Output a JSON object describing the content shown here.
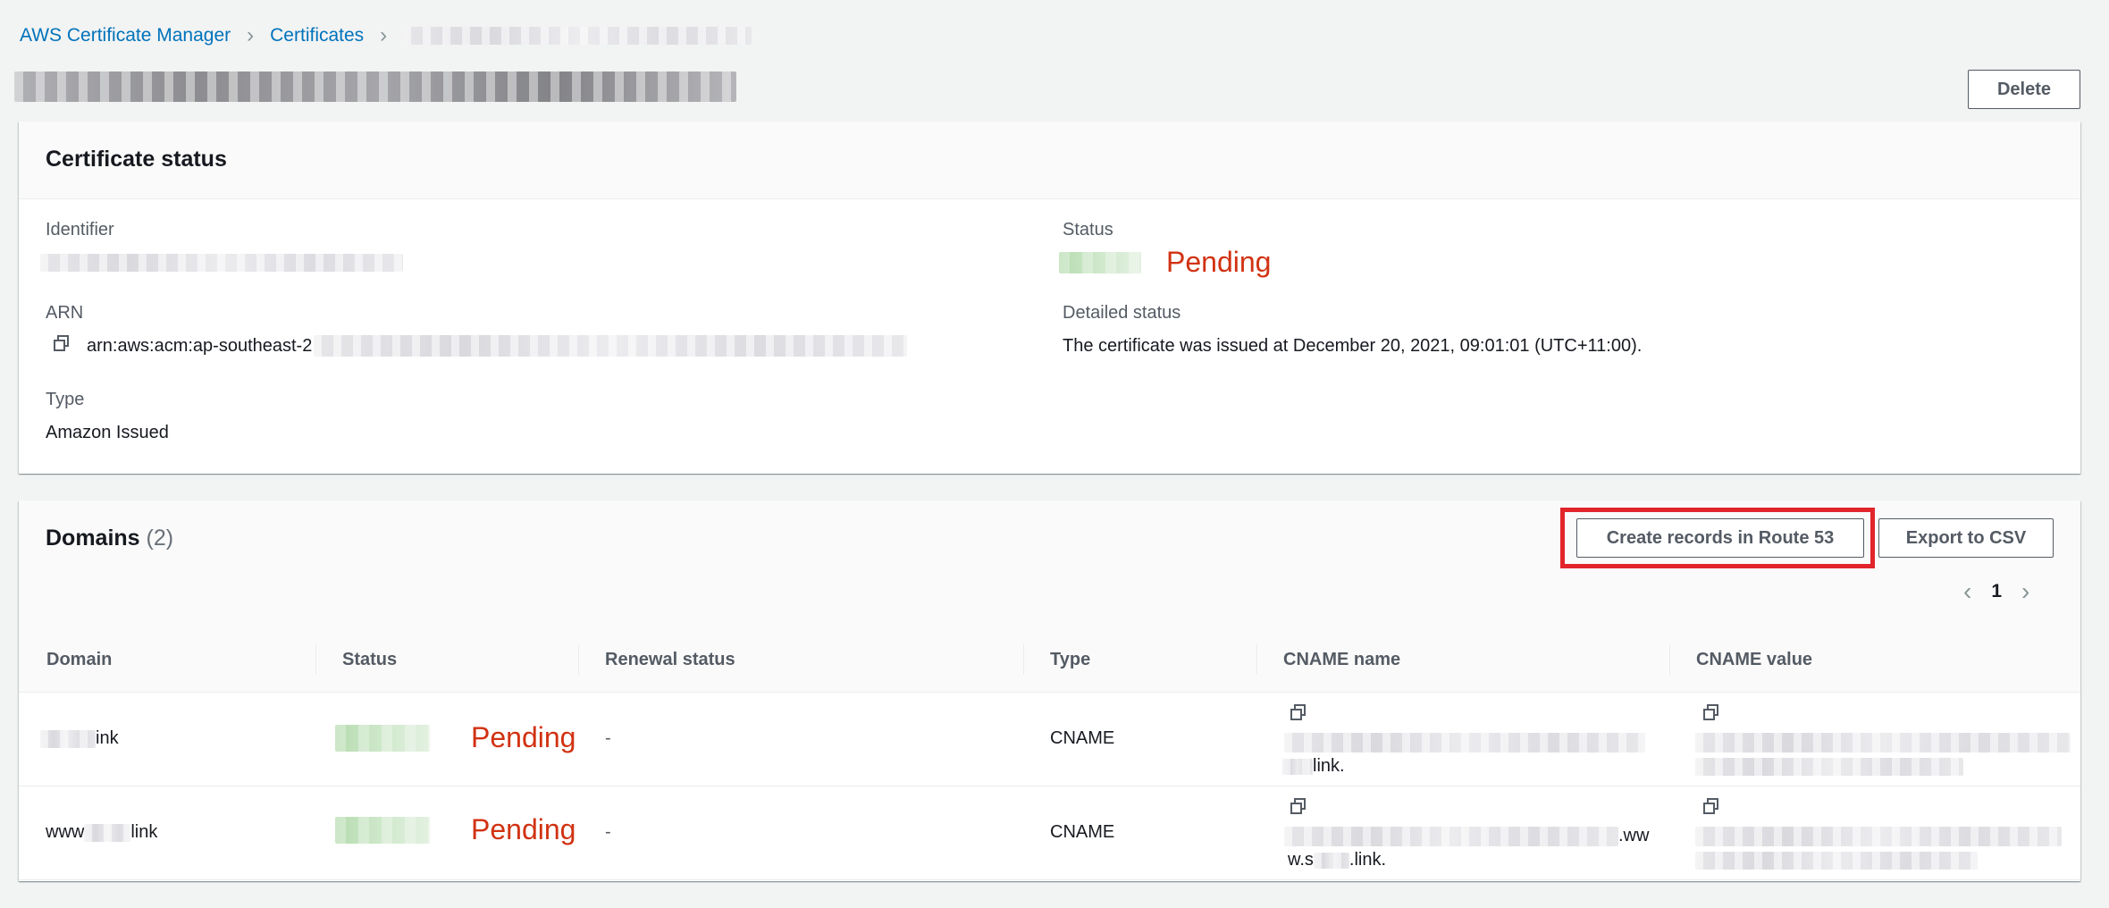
{
  "breadcrumb": {
    "items": [
      "AWS Certificate Manager",
      "Certificates"
    ]
  },
  "header": {
    "delete_label": "Delete"
  },
  "certificate_status": {
    "title": "Certificate status",
    "identifier_label": "Identifier",
    "arn_label": "ARN",
    "arn_value": "arn:aws:acm:ap-southeast-2",
    "type_label": "Type",
    "type_value": "Amazon Issued",
    "status_label": "Status",
    "status_value": "Pending",
    "detailed_status_label": "Detailed status",
    "detailed_status_value": "The certificate was issued at December 20, 2021, 09:01:01 (UTC+11:00)."
  },
  "domains": {
    "title": "Domains",
    "count": "(2)",
    "create_records_label": "Create records in Route 53",
    "export_label": "Export to CSV",
    "page_number": "1",
    "columns": [
      "Domain",
      "Status",
      "Renewal status",
      "Type",
      "CNAME name",
      "CNAME value"
    ],
    "rows": [
      {
        "domain_prefix": "",
        "domain_suffix": "ink",
        "status": "Pending",
        "renewal": "-",
        "type": "CNAME",
        "cname_name_tail": "link."
      },
      {
        "domain_prefix": "www",
        "domain_suffix": "link",
        "status": "Pending",
        "renewal": "-",
        "type": "CNAME",
        "cname_name_mid": ".ww",
        "cname_name_tail_a": "w.s",
        "cname_name_tail_b": ".link."
      }
    ]
  },
  "colors": {
    "link": "#0073bb",
    "pending": "#d13212",
    "highlight": "#e2242b"
  },
  "icons": [
    "chevron-right-icon",
    "copy-icon",
    "chevron-left-icon"
  ]
}
